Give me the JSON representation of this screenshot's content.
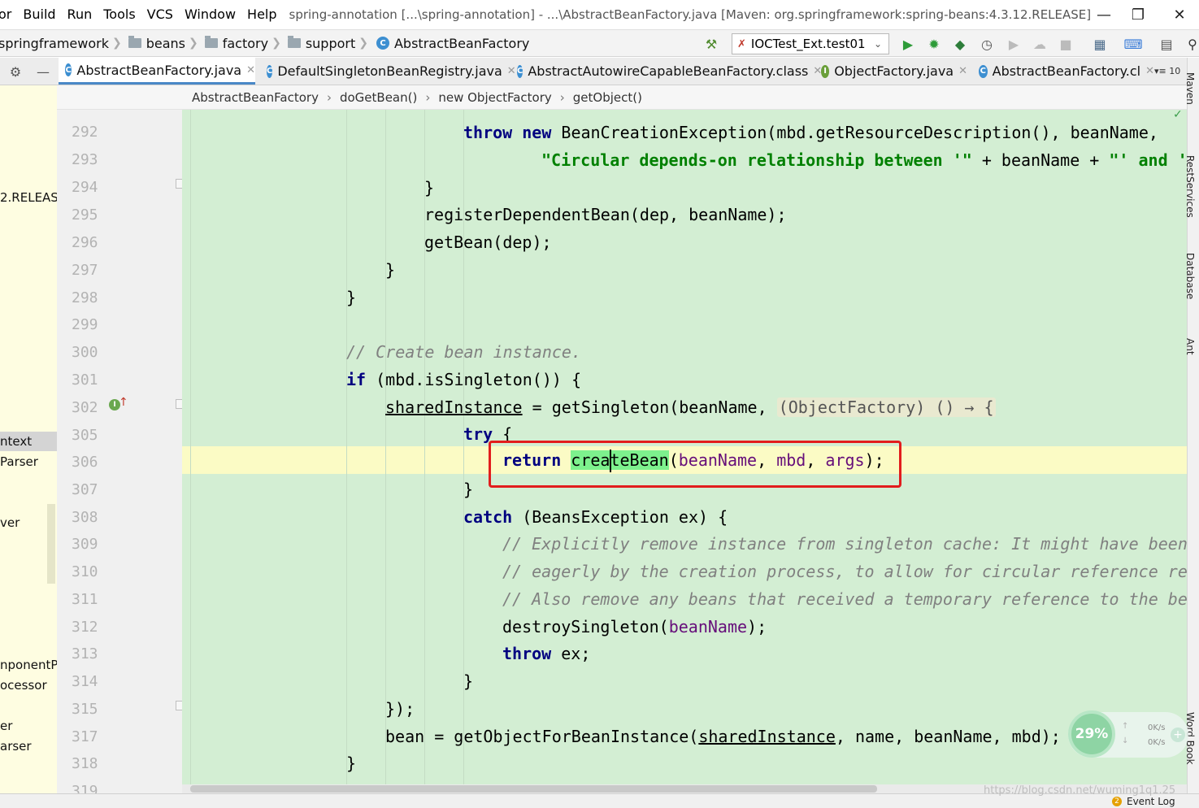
{
  "menu": {
    "items": [
      "or",
      "Build",
      "Run",
      "Tools",
      "VCS",
      "Window",
      "Help"
    ],
    "window_title": "spring-annotation [...\\spring-annotation] - ...\\AbstractBeanFactory.java [Maven: org.springframework:spring-beans:4.3.12.RELEASE]"
  },
  "nav": {
    "crumbs": [
      "springframework",
      "beans",
      "factory",
      "support",
      "AbstractBeanFactory"
    ],
    "run_config": "IOCTest_Ext.test01"
  },
  "tabs": [
    {
      "label": "AbstractBeanFactory.java",
      "active": true
    },
    {
      "label": "DefaultSingletonBeanRegistry.java",
      "active": false
    },
    {
      "label": "AbstractAutowireCapableBeanFactory.class",
      "active": false
    },
    {
      "label": "ObjectFactory.java",
      "active": false
    },
    {
      "label": "AbstractBeanFactory.cl",
      "active": false
    }
  ],
  "tab_overflow": "▾≡ 10",
  "editor_crumbs": [
    "AbstractBeanFactory",
    "doGetBean()",
    "new ObjectFactory",
    "getObject()"
  ],
  "left_panel": {
    "items": [
      "2.RELEASE",
      "ntext",
      "Parser",
      "ver",
      "nponentPr",
      "ocessor",
      "er",
      "arser"
    ]
  },
  "line_numbers": [
    "292",
    "293",
    "294",
    "295",
    "296",
    "297",
    "298",
    "299",
    "300",
    "301",
    "302",
    "305",
    "306",
    "307",
    "308",
    "309",
    "310",
    "311",
    "312",
    "313",
    "314",
    "315",
    "317",
    "318",
    "319"
  ],
  "code": {
    "l292_kw1": "throw",
    "l292_kw2": "new",
    "l292_rest": " BeanCreationException(mbd.getResourceDescription(), beanName,",
    "l293_str": "\"Circular depends-on relationship between '\"",
    "l293_mid": " + beanName + ",
    "l293_str2": "\"' and '",
    "l294": "}",
    "l295": "registerDependentBean(dep, beanName);",
    "l296": "getBean(dep);",
    "l297": "}",
    "l298": "}",
    "l300_cmt": "// Create bean instance.",
    "l301_kw": "if",
    "l301_rest": " (mbd.isSingleton()) {",
    "l302_var": "sharedInstance",
    "l302_mid": " = getSingleton(beanName, ",
    "l302_hint": "(ObjectFactory) () → {",
    "l305_kw": "try",
    "l305_rest": " {",
    "l306_kw": "return",
    "l306_sel_a": "crea",
    "l306_sel_b": "teBean",
    "l306_open": "(",
    "l306_p1": "beanName",
    "l306_c1": ", ",
    "l306_p2": "mbd",
    "l306_c2": ", ",
    "l306_p3": "args",
    "l306_close": ");",
    "l307": "}",
    "l308_kw": "catch",
    "l308_rest": " (BeansException ex) {",
    "l309_cmt": "// Explicitly remove instance from singleton cache: It might have been",
    "l310_cmt": "// eagerly by the creation process, to allow for circular reference re",
    "l311_cmt": "// Also remove any beans that received a temporary reference to the be",
    "l312_a": "destroySingleton(",
    "l312_p": "beanName",
    "l312_b": ");",
    "l313_kw": "throw",
    "l313_rest": " ex;",
    "l314": "}",
    "l315": "});",
    "l317_a": "bean = getObjectForBeanInstance(",
    "l317_var": "sharedInstance",
    "l317_b": ", name, beanName, mbd);",
    "l318": "}"
  },
  "right_strip": [
    "Maven",
    "RestServices",
    "Database",
    "Ant",
    "Word Book"
  ],
  "net_widget": {
    "percent": "29%",
    "up": "0K/s",
    "down": "0K/s"
  },
  "status": {
    "event_log": "Event Log",
    "watermark": "https://blog.csdn.net/wuming1q1.25"
  },
  "colors": {
    "keyword": "#000080",
    "string": "#008000",
    "comment": "#808080",
    "param": "#660e7a",
    "changed_bg": "#d3eed3",
    "caret_row": "#fbfbc5",
    "usage_highlight": "#7df18d",
    "annotation_box": "#e21d1d"
  }
}
